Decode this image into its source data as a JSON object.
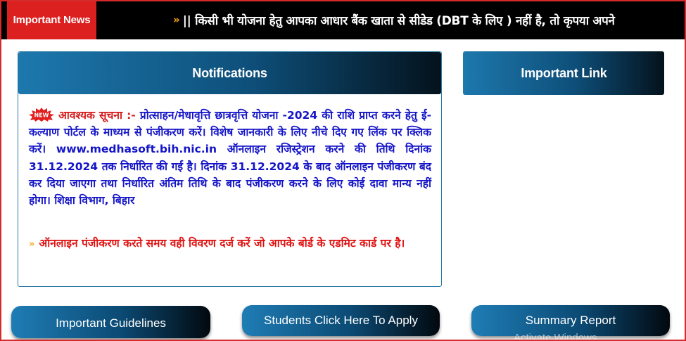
{
  "news": {
    "label": "Important News",
    "ticker_text": "|| किसी भी योजना हेतु आपका आधार बैंक खाता से सीडेड (DBT के लिए ) नहीं है, तो कृपया अपने"
  },
  "notifications": {
    "title": "Notifications",
    "notice_label": "आवश्यक सूचना :-",
    "notice_text": "प्रोत्साहन/मेधावृत्ति छात्रवृत्ति योजना -2024 की राशि प्राप्त करने हेतु ई- कल्याण पोर्टल के माध्यम से पंजीकरण करें। विशेष जानकारी के लिए नीचे दिए गए लिंक पर क्लिक करें। www.medhasoft.bih.nic.in ऑनलाइन रजिस्ट्रेशन करने की तिथि दिनांक 31.12.2024 तक निर्धारित की गई है। दिनांक 31.12.2024 के बाद ऑनलाइन पंजीकरण बंद कर दिया जाएगा तथा निर्धारित अंतिम तिथि के बाद पंजीकरण करने के लिए कोई दावा मान्य नहीं होगा। शिक्षा विभाग, बिहार",
    "second_notice": "ऑनलाइन पंजीकरण करते समय वही विवरण दर्ज करें जो आपके बोर्ड के एडमिट कार्ड पर है।",
    "new_badge": "NEW"
  },
  "important_link": {
    "title": "Important Link"
  },
  "buttons": {
    "guidelines": "Important Guidelines",
    "apply": "Students Click Here To Apply",
    "summary": "Summary Report"
  },
  "watermark": "Activate Windows",
  "colors": {
    "news_label_bg": "#dc1f1f",
    "notice_label": "#d61b1b",
    "notice_text": "#1414c8",
    "second_notice": "#e01010",
    "header_gradient_start": "#1d78ad",
    "header_gradient_end": "#04121c"
  },
  "icons": {
    "ticker": "double-chevron-right-icon",
    "new": "new-badge-icon",
    "second_notice": "double-chevron-right-icon"
  }
}
